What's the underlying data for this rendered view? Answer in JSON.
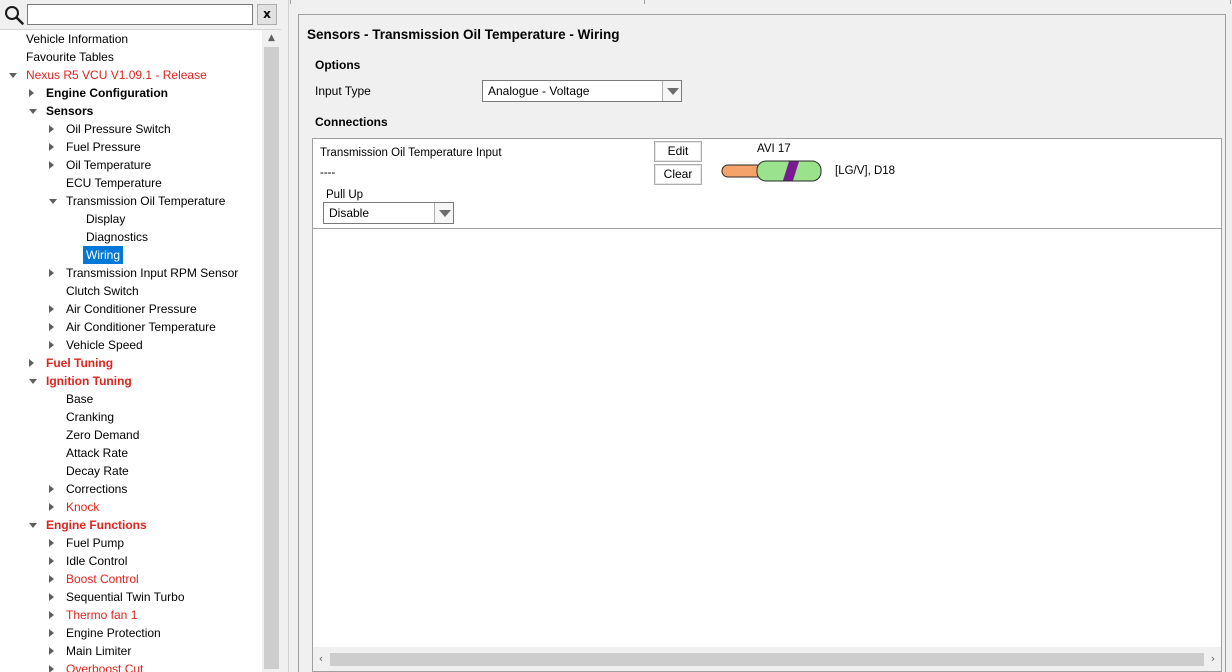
{
  "search": {
    "value": "",
    "placeholder": "",
    "clear_label": "x"
  },
  "tree": [
    {
      "label": "Vehicle Information",
      "style": "normal"
    },
    {
      "label": "Favourite Tables",
      "style": "normal"
    },
    {
      "label": "Nexus R5 VCU V1.09.1 - Release",
      "style": "red",
      "expander": "expanded"
    },
    {
      "label": "Engine Configuration",
      "style": "bold",
      "expander": "collapsed"
    },
    {
      "label": "Sensors",
      "style": "bold",
      "expander": "expanded"
    },
    {
      "label": "Oil Pressure Switch",
      "style": "normal",
      "expander": "collapsed"
    },
    {
      "label": "Fuel Pressure",
      "style": "normal",
      "expander": "collapsed"
    },
    {
      "label": "Oil Temperature",
      "style": "normal",
      "expander": "collapsed"
    },
    {
      "label": "ECU Temperature",
      "style": "normal"
    },
    {
      "label": "Transmission Oil Temperature",
      "style": "normal",
      "expander": "expanded"
    },
    {
      "label": "Display",
      "style": "normal"
    },
    {
      "label": "Diagnostics",
      "style": "normal"
    },
    {
      "label": "Wiring",
      "style": "selected"
    },
    {
      "label": "Transmission Input RPM Sensor",
      "style": "normal",
      "expander": "collapsed"
    },
    {
      "label": "Clutch Switch",
      "style": "normal"
    },
    {
      "label": "Air Conditioner Pressure",
      "style": "normal",
      "expander": "collapsed"
    },
    {
      "label": "Air Conditioner Temperature",
      "style": "normal",
      "expander": "collapsed"
    },
    {
      "label": "Vehicle Speed",
      "style": "normal",
      "expander": "collapsed"
    },
    {
      "label": "Fuel Tuning",
      "style": "bold-red",
      "expander": "collapsed"
    },
    {
      "label": "Ignition Tuning",
      "style": "bold-red",
      "expander": "expanded"
    },
    {
      "label": "Base",
      "style": "normal"
    },
    {
      "label": "Cranking",
      "style": "normal"
    },
    {
      "label": "Zero Demand",
      "style": "normal"
    },
    {
      "label": "Attack Rate",
      "style": "normal"
    },
    {
      "label": "Decay Rate",
      "style": "normal"
    },
    {
      "label": "Corrections",
      "style": "normal",
      "expander": "collapsed"
    },
    {
      "label": "Knock",
      "style": "red",
      "expander": "collapsed"
    },
    {
      "label": "Engine Functions",
      "style": "bold-red",
      "expander": "expanded"
    },
    {
      "label": "Fuel Pump",
      "style": "normal",
      "expander": "collapsed"
    },
    {
      "label": "Idle Control",
      "style": "normal",
      "expander": "collapsed"
    },
    {
      "label": "Boost Control",
      "style": "red",
      "expander": "collapsed"
    },
    {
      "label": "Sequential Twin Turbo",
      "style": "normal",
      "expander": "collapsed"
    },
    {
      "label": "Thermo fan 1",
      "style": "red",
      "expander": "collapsed"
    },
    {
      "label": "Engine Protection",
      "style": "normal",
      "expander": "collapsed"
    },
    {
      "label": "Main Limiter",
      "style": "normal",
      "expander": "collapsed"
    },
    {
      "label": "Overboost Cut",
      "style": "red",
      "expander": "collapsed"
    }
  ],
  "page": {
    "title": "Sensors - Transmission Oil Temperature - Wiring",
    "options_heading": "Options",
    "input_type_label": "Input Type",
    "input_type_value": "Analogue - Voltage",
    "connections_heading": "Connections"
  },
  "connection": {
    "input_name": "Transmission Oil Temperature Input",
    "value": "----",
    "edit_label": "Edit",
    "clear_label": "Clear",
    "pin_label": "AVI 17",
    "wire_desc": "[LG/V], D18",
    "pullup_label": "Pull Up",
    "pullup_value": "Disable"
  },
  "icons": {
    "search": "search-icon",
    "clear": "close-icon",
    "dropdown": "chevron-down-icon",
    "scroll_up": "scroll-up-arrow-icon",
    "scroll_left": "scroll-left-arrow-icon",
    "scroll_right": "scroll-right-arrow-icon",
    "wire": "wire-icon"
  },
  "colors": {
    "accent_selected": "#0078d7",
    "warning_text": "#e0241e",
    "wire_green": "#9be28c",
    "wire_stripe": "#7a1a93",
    "wire_core": "#f5a36a"
  }
}
